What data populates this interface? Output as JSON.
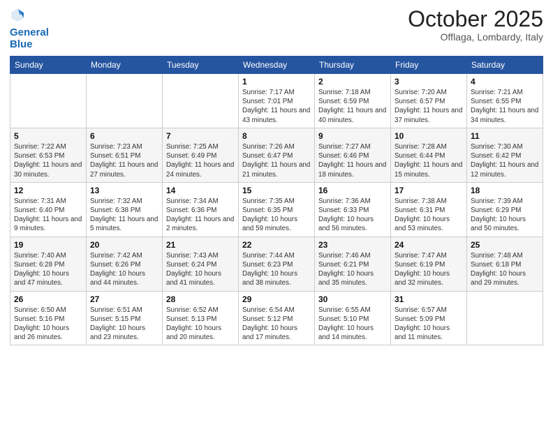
{
  "header": {
    "logo_line1": "General",
    "logo_line2": "Blue",
    "month": "October 2025",
    "location": "Offlaga, Lombardy, Italy"
  },
  "weekdays": [
    "Sunday",
    "Monday",
    "Tuesday",
    "Wednesday",
    "Thursday",
    "Friday",
    "Saturday"
  ],
  "weeks": [
    [
      {
        "day": "",
        "sunrise": "",
        "sunset": "",
        "daylight": ""
      },
      {
        "day": "",
        "sunrise": "",
        "sunset": "",
        "daylight": ""
      },
      {
        "day": "",
        "sunrise": "",
        "sunset": "",
        "daylight": ""
      },
      {
        "day": "1",
        "sunrise": "Sunrise: 7:17 AM",
        "sunset": "Sunset: 7:01 PM",
        "daylight": "Daylight: 11 hours and 43 minutes."
      },
      {
        "day": "2",
        "sunrise": "Sunrise: 7:18 AM",
        "sunset": "Sunset: 6:59 PM",
        "daylight": "Daylight: 11 hours and 40 minutes."
      },
      {
        "day": "3",
        "sunrise": "Sunrise: 7:20 AM",
        "sunset": "Sunset: 6:57 PM",
        "daylight": "Daylight: 11 hours and 37 minutes."
      },
      {
        "day": "4",
        "sunrise": "Sunrise: 7:21 AM",
        "sunset": "Sunset: 6:55 PM",
        "daylight": "Daylight: 11 hours and 34 minutes."
      }
    ],
    [
      {
        "day": "5",
        "sunrise": "Sunrise: 7:22 AM",
        "sunset": "Sunset: 6:53 PM",
        "daylight": "Daylight: 11 hours and 30 minutes."
      },
      {
        "day": "6",
        "sunrise": "Sunrise: 7:23 AM",
        "sunset": "Sunset: 6:51 PM",
        "daylight": "Daylight: 11 hours and 27 minutes."
      },
      {
        "day": "7",
        "sunrise": "Sunrise: 7:25 AM",
        "sunset": "Sunset: 6:49 PM",
        "daylight": "Daylight: 11 hours and 24 minutes."
      },
      {
        "day": "8",
        "sunrise": "Sunrise: 7:26 AM",
        "sunset": "Sunset: 6:47 PM",
        "daylight": "Daylight: 11 hours and 21 minutes."
      },
      {
        "day": "9",
        "sunrise": "Sunrise: 7:27 AM",
        "sunset": "Sunset: 6:46 PM",
        "daylight": "Daylight: 11 hours and 18 minutes."
      },
      {
        "day": "10",
        "sunrise": "Sunrise: 7:28 AM",
        "sunset": "Sunset: 6:44 PM",
        "daylight": "Daylight: 11 hours and 15 minutes."
      },
      {
        "day": "11",
        "sunrise": "Sunrise: 7:30 AM",
        "sunset": "Sunset: 6:42 PM",
        "daylight": "Daylight: 11 hours and 12 minutes."
      }
    ],
    [
      {
        "day": "12",
        "sunrise": "Sunrise: 7:31 AM",
        "sunset": "Sunset: 6:40 PM",
        "daylight": "Daylight: 11 hours and 9 minutes."
      },
      {
        "day": "13",
        "sunrise": "Sunrise: 7:32 AM",
        "sunset": "Sunset: 6:38 PM",
        "daylight": "Daylight: 11 hours and 5 minutes."
      },
      {
        "day": "14",
        "sunrise": "Sunrise: 7:34 AM",
        "sunset": "Sunset: 6:36 PM",
        "daylight": "Daylight: 11 hours and 2 minutes."
      },
      {
        "day": "15",
        "sunrise": "Sunrise: 7:35 AM",
        "sunset": "Sunset: 6:35 PM",
        "daylight": "Daylight: 10 hours and 59 minutes."
      },
      {
        "day": "16",
        "sunrise": "Sunrise: 7:36 AM",
        "sunset": "Sunset: 6:33 PM",
        "daylight": "Daylight: 10 hours and 56 minutes."
      },
      {
        "day": "17",
        "sunrise": "Sunrise: 7:38 AM",
        "sunset": "Sunset: 6:31 PM",
        "daylight": "Daylight: 10 hours and 53 minutes."
      },
      {
        "day": "18",
        "sunrise": "Sunrise: 7:39 AM",
        "sunset": "Sunset: 6:29 PM",
        "daylight": "Daylight: 10 hours and 50 minutes."
      }
    ],
    [
      {
        "day": "19",
        "sunrise": "Sunrise: 7:40 AM",
        "sunset": "Sunset: 6:28 PM",
        "daylight": "Daylight: 10 hours and 47 minutes."
      },
      {
        "day": "20",
        "sunrise": "Sunrise: 7:42 AM",
        "sunset": "Sunset: 6:26 PM",
        "daylight": "Daylight: 10 hours and 44 minutes."
      },
      {
        "day": "21",
        "sunrise": "Sunrise: 7:43 AM",
        "sunset": "Sunset: 6:24 PM",
        "daylight": "Daylight: 10 hours and 41 minutes."
      },
      {
        "day": "22",
        "sunrise": "Sunrise: 7:44 AM",
        "sunset": "Sunset: 6:23 PM",
        "daylight": "Daylight: 10 hours and 38 minutes."
      },
      {
        "day": "23",
        "sunrise": "Sunrise: 7:46 AM",
        "sunset": "Sunset: 6:21 PM",
        "daylight": "Daylight: 10 hours and 35 minutes."
      },
      {
        "day": "24",
        "sunrise": "Sunrise: 7:47 AM",
        "sunset": "Sunset: 6:19 PM",
        "daylight": "Daylight: 10 hours and 32 minutes."
      },
      {
        "day": "25",
        "sunrise": "Sunrise: 7:48 AM",
        "sunset": "Sunset: 6:18 PM",
        "daylight": "Daylight: 10 hours and 29 minutes."
      }
    ],
    [
      {
        "day": "26",
        "sunrise": "Sunrise: 6:50 AM",
        "sunset": "Sunset: 5:16 PM",
        "daylight": "Daylight: 10 hours and 26 minutes."
      },
      {
        "day": "27",
        "sunrise": "Sunrise: 6:51 AM",
        "sunset": "Sunset: 5:15 PM",
        "daylight": "Daylight: 10 hours and 23 minutes."
      },
      {
        "day": "28",
        "sunrise": "Sunrise: 6:52 AM",
        "sunset": "Sunset: 5:13 PM",
        "daylight": "Daylight: 10 hours and 20 minutes."
      },
      {
        "day": "29",
        "sunrise": "Sunrise: 6:54 AM",
        "sunset": "Sunset: 5:12 PM",
        "daylight": "Daylight: 10 hours and 17 minutes."
      },
      {
        "day": "30",
        "sunrise": "Sunrise: 6:55 AM",
        "sunset": "Sunset: 5:10 PM",
        "daylight": "Daylight: 10 hours and 14 minutes."
      },
      {
        "day": "31",
        "sunrise": "Sunrise: 6:57 AM",
        "sunset": "Sunset: 5:09 PM",
        "daylight": "Daylight: 10 hours and 11 minutes."
      },
      {
        "day": "",
        "sunrise": "",
        "sunset": "",
        "daylight": ""
      }
    ]
  ]
}
